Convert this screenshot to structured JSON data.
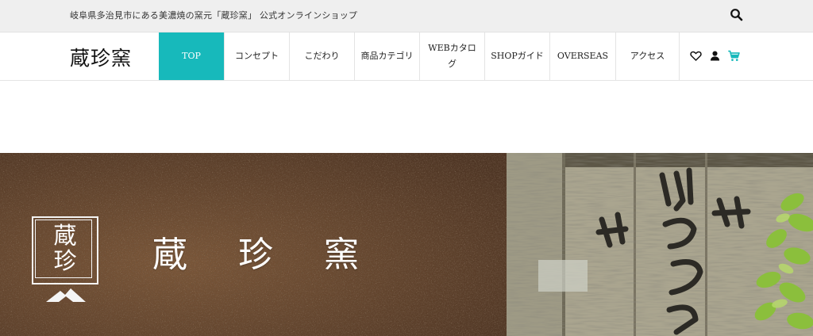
{
  "topbar": {
    "tagline": "岐阜県多治見市にある美濃焼の窯元「蔵珍窯」 公式オンラインショップ",
    "search_icon": "search-icon"
  },
  "header": {
    "logo": "蔵珍窯",
    "nav": [
      {
        "label": "TOP",
        "active": true
      },
      {
        "label": "コンセプト"
      },
      {
        "label": "こだわり"
      },
      {
        "label": "商品カテゴリ"
      },
      {
        "label": "WEBカタログ"
      },
      {
        "label": "SHOPガイド"
      },
      {
        "label": "OVERSEAS"
      },
      {
        "label": "アクセス"
      }
    ],
    "icons": [
      "heart-icon",
      "user-icon",
      "cart-icon"
    ]
  },
  "hero": {
    "mark_line1": "蔵",
    "mark_line2": "珍",
    "title": "蔵珍窯"
  },
  "colors": {
    "accent": "#17b9bb",
    "topbar_bg": "#efefef",
    "hero_wall": "#6b4b34",
    "noren": "#b7b29e"
  }
}
